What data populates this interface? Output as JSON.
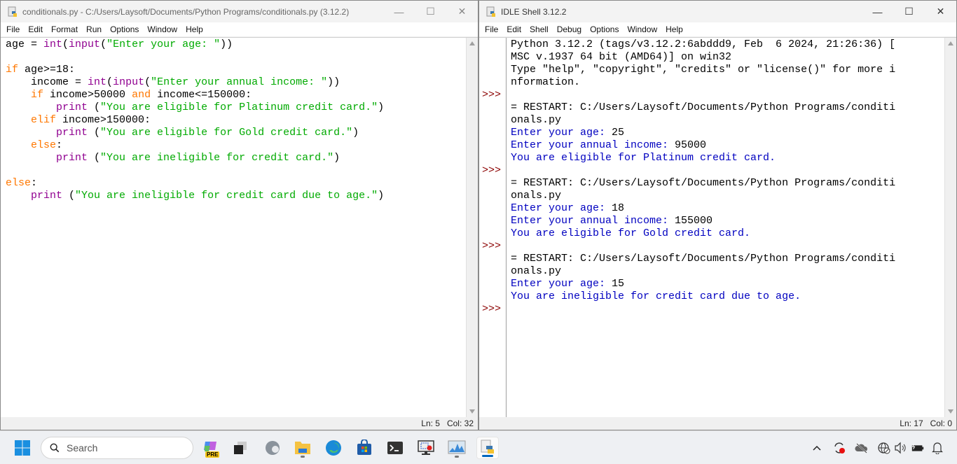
{
  "editor": {
    "title": "conditionals.py - C:/Users/Laysoft/Documents/Python Programs/conditionals.py (3.12.2)",
    "menu": [
      "File",
      "Edit",
      "Format",
      "Run",
      "Options",
      "Window",
      "Help"
    ],
    "status": {
      "line": "Ln: 5",
      "col": "Col: 32"
    },
    "code_lines": [
      [
        [
          "age = ",
          ""
        ],
        [
          "int",
          "bi"
        ],
        [
          "(",
          ""
        ],
        [
          "input",
          "bi"
        ],
        [
          "(",
          ""
        ],
        [
          "\"Enter your age: \"",
          "str"
        ],
        [
          "))",
          ""
        ]
      ],
      [],
      [
        [
          "if",
          "kw"
        ],
        [
          " age>=18:",
          ""
        ]
      ],
      [
        [
          "    income = ",
          ""
        ],
        [
          "int",
          "bi"
        ],
        [
          "(",
          ""
        ],
        [
          "input",
          "bi"
        ],
        [
          "(",
          ""
        ],
        [
          "\"Enter your annual income: \"",
          "str"
        ],
        [
          "))",
          ""
        ]
      ],
      [
        [
          "    ",
          ""
        ],
        [
          "if",
          "kw"
        ],
        [
          " income>50000 ",
          ""
        ],
        [
          "and",
          "kw"
        ],
        [
          " income<=150000:",
          ""
        ]
      ],
      [
        [
          "        ",
          ""
        ],
        [
          "print",
          "bi"
        ],
        [
          " (",
          ""
        ],
        [
          "\"You are eligible for Platinum credit card.\"",
          "str"
        ],
        [
          ")",
          ""
        ]
      ],
      [
        [
          "    ",
          ""
        ],
        [
          "elif",
          "kw"
        ],
        [
          " income>150000:",
          ""
        ]
      ],
      [
        [
          "        ",
          ""
        ],
        [
          "print",
          "bi"
        ],
        [
          " (",
          ""
        ],
        [
          "\"You are eligible for Gold credit card.\"",
          "str"
        ],
        [
          ")",
          ""
        ]
      ],
      [
        [
          "    ",
          ""
        ],
        [
          "else",
          "kw"
        ],
        [
          ":",
          ""
        ]
      ],
      [
        [
          "        ",
          ""
        ],
        [
          "print",
          "bi"
        ],
        [
          " (",
          ""
        ],
        [
          "\"You are ineligible for credit card.\"",
          "str"
        ],
        [
          ")",
          ""
        ]
      ],
      [],
      [
        [
          "else",
          "kw"
        ],
        [
          ":",
          ""
        ]
      ],
      [
        [
          "    ",
          ""
        ],
        [
          "print",
          "bi"
        ],
        [
          " (",
          ""
        ],
        [
          "\"You are ineligible for credit card due to age.\"",
          "str"
        ],
        [
          ")",
          ""
        ]
      ]
    ]
  },
  "shell": {
    "title": "IDLE Shell 3.12.2",
    "menu": [
      "File",
      "Edit",
      "Shell",
      "Debug",
      "Options",
      "Window",
      "Help"
    ],
    "status": {
      "line": "Ln: 17",
      "col": "Col: 0"
    },
    "prompt": ">>>",
    "prompt_rows": [
      4,
      10,
      16,
      21
    ],
    "lines": [
      [
        "Python 3.12.2 (tags/v3.12.2:6abddd9, Feb  6 2024, 21:26:36) [",
        "out"
      ],
      [
        "MSC v.1937 64 bit (AMD64)] on win32",
        "out"
      ],
      [
        "Type \"help\", \"copyright\", \"credits\" or \"license()\" for more i",
        "out"
      ],
      [
        "nformation.",
        "out"
      ],
      [
        "",
        "out"
      ],
      [
        "= RESTART: C:/Users/Laysoft/Documents/Python Programs/conditi",
        "out"
      ],
      [
        "onals.py",
        "out"
      ],
      [
        "Enter your age: |25",
        "stdout"
      ],
      [
        "Enter your annual income: |95000",
        "stdout"
      ],
      [
        "You are eligible for Platinum credit card.",
        "stdout"
      ],
      [
        "",
        "out"
      ],
      [
        "= RESTART: C:/Users/Laysoft/Documents/Python Programs/conditi",
        "out"
      ],
      [
        "onals.py",
        "out"
      ],
      [
        "Enter your age: |18",
        "stdout"
      ],
      [
        "Enter your annual income: |155000",
        "stdout"
      ],
      [
        "You are eligible for Gold credit card.",
        "stdout"
      ],
      [
        "",
        "out"
      ],
      [
        "= RESTART: C:/Users/Laysoft/Documents/Python Programs/conditi",
        "out"
      ],
      [
        "onals.py",
        "out"
      ],
      [
        "Enter your age: |15",
        "stdout"
      ],
      [
        "You are ineligible for credit card due to age.",
        "stdout"
      ],
      [
        "",
        "out"
      ]
    ]
  },
  "taskbar": {
    "search_placeholder": "Search",
    "copilot_badge": "PRE",
    "apps": [
      "start-icon",
      "copilot-icon",
      "task-view-icon",
      "edge-beta-icon",
      "file-explorer-icon",
      "edge-icon",
      "store-icon",
      "terminal-icon",
      "screen-recorder-icon",
      "performance-monitor-icon",
      "python-idle-icon"
    ],
    "tray": [
      "show-hidden-icons",
      "sync-icon",
      "onedrive-icon",
      "network-icon",
      "volume-icon",
      "battery-icon",
      "notifications-icon"
    ]
  },
  "colors": {
    "keyword": "#ff7700",
    "builtin": "#900090",
    "string": "#00aa00",
    "stdout": "#0000c0",
    "prompt": "#8b0000"
  }
}
